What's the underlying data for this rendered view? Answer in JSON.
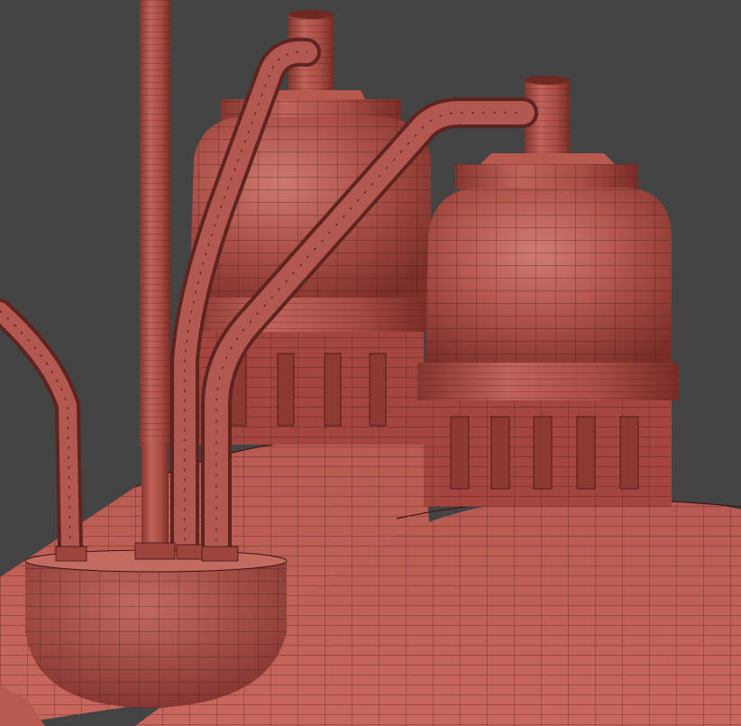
{
  "scene": {
    "subject": "wireframe-render",
    "colors": {
      "background": "#444444",
      "base": "#b5574e",
      "light": "#cd7268",
      "shadow": "#7d2f29",
      "wire": "#3a1512"
    }
  }
}
